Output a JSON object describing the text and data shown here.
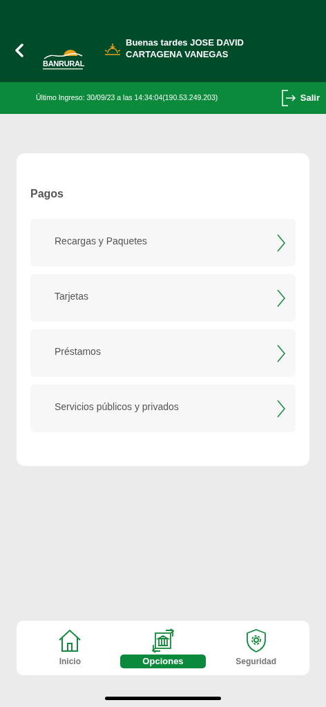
{
  "header": {
    "logo": {
      "name": "BANRURAL"
    },
    "greeting": "Buenas tardes JOSE DAVID CARTAGENA VANEGAS"
  },
  "session_bar": {
    "last_login": "Último Ingreso: 30/09/23 a las 14:34:04(190.53.249.203)",
    "logout": "Salir"
  },
  "section": {
    "title": "Pagos",
    "items": [
      {
        "label": "Recargas y Paquetes"
      },
      {
        "label": "Tarjetas"
      },
      {
        "label": "Préstamos"
      },
      {
        "label": "Servicios públicos y privados"
      }
    ]
  },
  "bottom_nav": [
    {
      "kind": "home",
      "label": "Inicio",
      "selected": false
    },
    {
      "kind": "options",
      "label": "Opciones",
      "selected": true
    },
    {
      "kind": "security",
      "label": "Seguridad",
      "selected": false
    }
  ]
}
